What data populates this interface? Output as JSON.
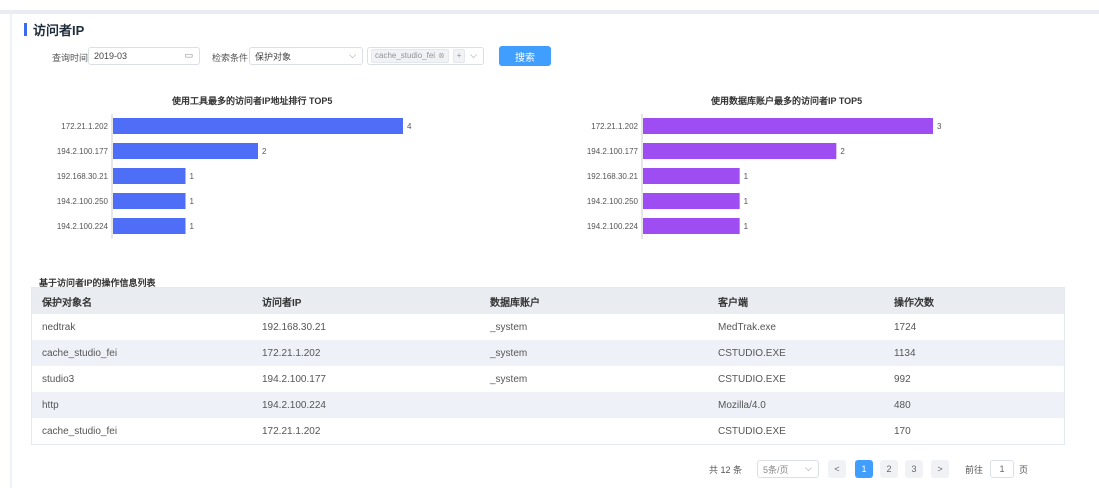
{
  "page": {
    "title": "访问者IP"
  },
  "filters": {
    "date_label": "查询时间",
    "date_value": "2019-03",
    "cond_label": "检索条件",
    "cond_select": "保护对象",
    "tag_value": "cache_studio_fei",
    "tag_more": "+",
    "search_button": "搜索"
  },
  "chart_data": [
    {
      "type": "bar",
      "title": "使用工具最多的访问者IP地址排行 TOP5",
      "categories": [
        "172.21.1.202",
        "194.2.100.177",
        "192.168.30.21",
        "194.2.100.250",
        "194.2.100.224"
      ],
      "values": [
        4,
        2,
        1,
        1,
        1
      ],
      "color": "#4f6ef7",
      "orientation": "horizontal"
    },
    {
      "type": "bar",
      "title": "使用数据库账户最多的访问者IP TOP5",
      "categories": [
        "172.21.1.202",
        "194.2.100.177",
        "192.168.30.21",
        "194.2.100.250",
        "194.2.100.224"
      ],
      "values": [
        3,
        2,
        1,
        1,
        1
      ],
      "color": "#9d4df2",
      "orientation": "horizontal"
    }
  ],
  "list": {
    "title": "基于访问者IP的操作信息列表",
    "columns": [
      "保护对象名",
      "访问者IP",
      "数据库账户",
      "客户端",
      "操作次数"
    ],
    "rows": [
      [
        "nedtrak",
        "192.168.30.21",
        "_system",
        "MedTrak.exe",
        "1724"
      ],
      [
        "cache_studio_fei",
        "172.21.1.202",
        "_system",
        "CSTUDIO.EXE",
        "1134"
      ],
      [
        "studio3",
        "194.2.100.177",
        "_system",
        "CSTUDIO.EXE",
        "992"
      ],
      [
        "http",
        "194.2.100.224",
        "",
        "Mozilla/4.0",
        "480"
      ],
      [
        "cache_studio_fei",
        "172.21.1.202",
        "",
        "CSTUDIO.EXE",
        "170"
      ]
    ]
  },
  "pagination": {
    "total": "共 12 条",
    "page_size": "5条/页",
    "prev": "<",
    "next": ">",
    "pages": [
      "1",
      "2",
      "3"
    ],
    "current": "1",
    "goto_label": "前往",
    "goto_value": "1",
    "goto_suffix": "页"
  },
  "colors": {
    "accent": "#409eff",
    "bar_blue": "#4f6ef7",
    "bar_purple": "#9d4df2"
  }
}
